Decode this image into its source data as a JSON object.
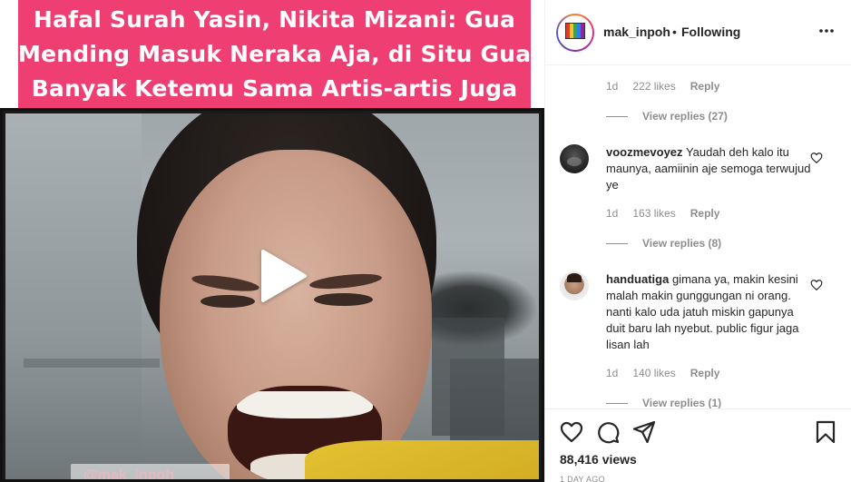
{
  "media": {
    "headline_lines": [
      "Hafal Surah Yasin, Nikita Mizani: Gua",
      "Mending Masuk Neraka Aja, di Situ Gua",
      "Banyak Ketemu Sama Artis-artis Juga"
    ],
    "watermark": "@mak_inpoh"
  },
  "header": {
    "username": "mak_inpoh",
    "separator": "•",
    "follow_status": "Following"
  },
  "comments": {
    "top_meta": {
      "time": "1d",
      "likes": "222 likes",
      "reply": "Reply"
    },
    "top_view_replies": "View replies (27)",
    "items": [
      {
        "username": "voozmevoyez",
        "text": "Yaudah deh kalo itu maunya, aamiinin aje semoga terwujud ye",
        "time": "1d",
        "likes": "163 likes",
        "reply": "Reply",
        "view_replies": "View replies (8)"
      },
      {
        "username": "handuatiga",
        "text": "gimana ya, makin kesini malah makin gunggungan ni orang. nanti kalo uda jatuh miskin gapunya duit baru lah nyebut. public figur jaga lisan lah",
        "time": "1d",
        "likes": "140 likes",
        "reply": "Reply",
        "view_replies": "View replies (1)"
      }
    ]
  },
  "footer": {
    "views": "88,416 views",
    "date": "1 DAY AGO"
  },
  "icons": {
    "play": "play-icon",
    "more": "more-options-icon",
    "like": "heart-icon",
    "comment": "comment-icon",
    "share": "share-icon",
    "save": "bookmark-icon"
  },
  "colors": {
    "headline_bg": "#ef3f72",
    "text_primary": "#262626",
    "text_secondary": "#8e8e8e",
    "divider": "#efefef"
  }
}
